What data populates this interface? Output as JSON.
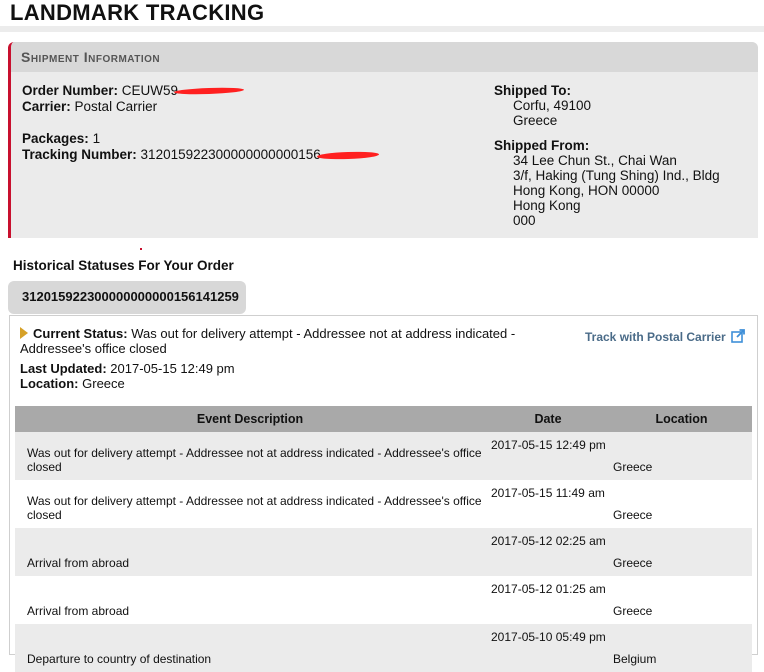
{
  "page": {
    "title": "LANDMARK TRACKING"
  },
  "shipment": {
    "header": "Shipment Information",
    "order_label": "Order Number:",
    "order_value": "CEUW59",
    "carrier_label": "Carrier:",
    "carrier_value": "Postal Carrier",
    "packages_label": "Packages:",
    "packages_value": "1",
    "tracking_label": "Tracking Number:",
    "tracking_value": "312015922300000000000156",
    "shipped_to": {
      "label": "Shipped To:",
      "lines": [
        "Corfu, 49100",
        "Greece"
      ]
    },
    "shipped_from": {
      "label": "Shipped From:",
      "lines": [
        "34 Lee Chun St., Chai Wan",
        "3/f, Haking (Tung Shing) Ind., Bldg",
        "Hong Kong, HON 00000",
        "Hong Kong",
        "000"
      ]
    }
  },
  "history": {
    "title": "Historical Statuses For Your Order",
    "tab_label": "312015922300000000000156141259",
    "current_status_label": "Current Status:",
    "current_status_value": "Was out for delivery attempt - Addressee not at address indicated - Addressee's office closed",
    "last_updated_label": "Last Updated:",
    "last_updated_value": "2017-05-15 12:49 pm",
    "location_label": "Location:",
    "location_value": "Greece",
    "track_link": "Track with Postal Carrier",
    "track_icon": "external-link-icon",
    "columns": [
      "Event Description",
      "Date",
      "Location"
    ],
    "rows": [
      {
        "description": "Was out for delivery attempt - Addressee not at address indicated - Addressee's office closed",
        "date": "2017-05-15 12:49 pm",
        "location": "Greece"
      },
      {
        "description": "Was out for delivery attempt - Addressee not at address indicated - Addressee's office closed",
        "date": "2017-05-15 11:49 am",
        "location": "Greece"
      },
      {
        "description": "Arrival from abroad",
        "date": "2017-05-12 02:25 am",
        "location": "Greece"
      },
      {
        "description": "Arrival from abroad",
        "date": "2017-05-12 01:25 am",
        "location": "Greece"
      },
      {
        "description": "Departure to country of destination",
        "date": "2017-05-10 05:49 pm",
        "location": "Belgium"
      }
    ]
  },
  "colors": {
    "accent_red": "#c8102e",
    "header_gray": "#d8d8d8",
    "table_header": "#a9a9a9",
    "link_blue": "#4a6b88",
    "status_arrow": "#d6a128"
  }
}
